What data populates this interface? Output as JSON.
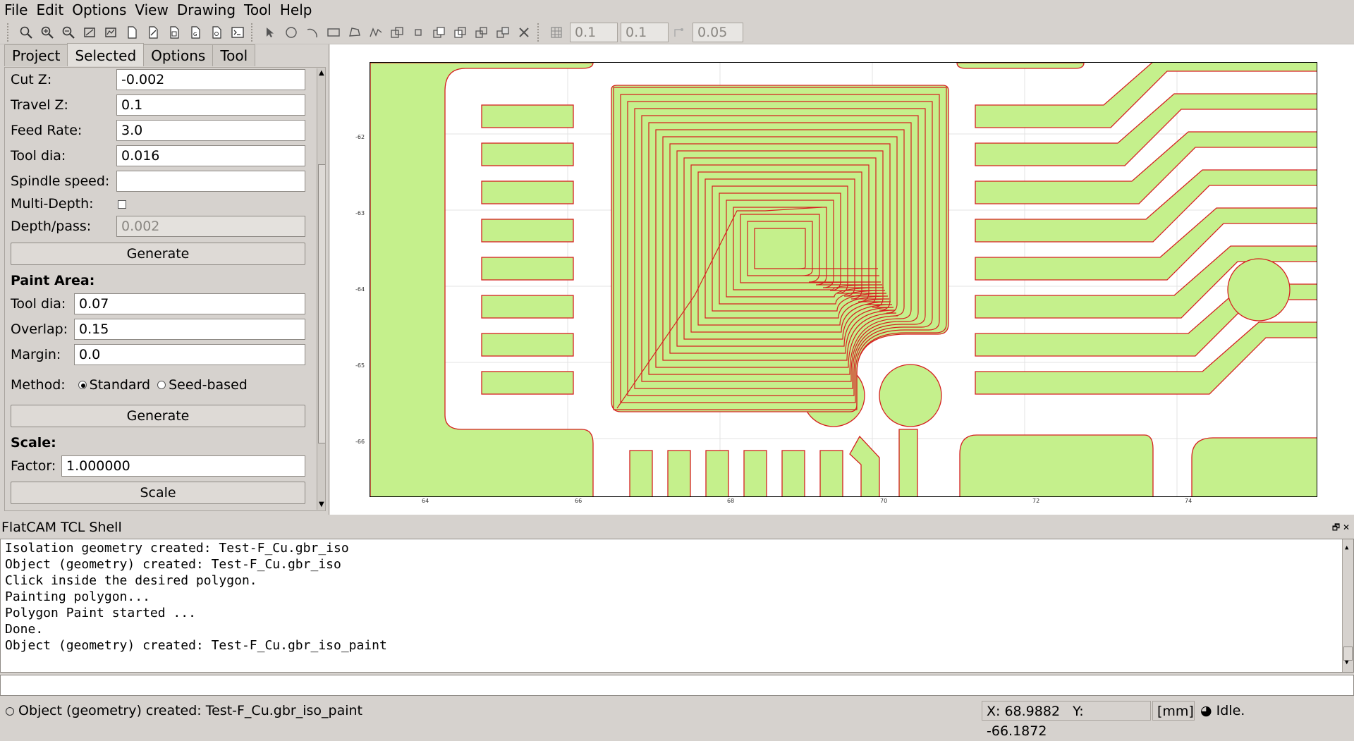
{
  "menu": [
    "File",
    "Edit",
    "Options",
    "View",
    "Drawing",
    "Tool",
    "Help"
  ],
  "toolbar": {
    "icons": [
      "zoom-fit-icon",
      "zoom-in-icon",
      "zoom-out-icon",
      "clear-plot-icon",
      "replot-icon",
      "new-geometry-icon",
      "edit-geometry-icon",
      "update-geometry-icon",
      "open-gerber-icon",
      "open-excellon-icon",
      "shell-icon",
      "select-icon",
      "circle-icon",
      "arc-icon",
      "rectangle-icon",
      "polygon-icon",
      "path-icon",
      "move-icon",
      "copy-icon",
      "union-icon",
      "intersection-icon",
      "subtraction-icon",
      "cut-icon",
      "delete-icon"
    ],
    "grid_x": "0.1",
    "grid_y": "0.1",
    "snap_max": "0.05"
  },
  "tabs": [
    "Project",
    "Selected",
    "Options",
    "Tool"
  ],
  "active_tab": "Selected",
  "form": {
    "cut_z_label": "Cut Z:",
    "cut_z": "-0.002",
    "travel_z_label": "Travel Z:",
    "travel_z": "0.1",
    "feed_rate_label": "Feed Rate:",
    "feed_rate": "3.0",
    "tool_dia_label": "Tool dia:",
    "tool_dia": "0.016",
    "spindle_label": "Spindle speed:",
    "spindle": "",
    "multidepth_label": "Multi-Depth:",
    "depth_pass_label": "Depth/pass:",
    "depth_pass": "0.002",
    "generate_label": "Generate",
    "paint_title": "Paint Area:",
    "paint_tool_dia_label": "Tool dia:",
    "paint_tool_dia": "0.07",
    "overlap_label": "Overlap:",
    "overlap": "0.15",
    "margin_label": "Margin:",
    "margin": "0.0",
    "method_label": "Method:",
    "method_standard": "Standard",
    "method_seed": "Seed-based",
    "generate2_label": "Generate",
    "scale_title": "Scale:",
    "factor_label": "Factor:",
    "factor": "1.000000",
    "scale_button": "Scale"
  },
  "plot": {
    "yticks": [
      "-62",
      "-63",
      "-64",
      "-65",
      "-66"
    ],
    "xticks": [
      "64",
      "66",
      "68",
      "70",
      "72",
      "74"
    ],
    "fill_color": "#c5f08c",
    "outline_color": "#d62020"
  },
  "shell": {
    "title": "FlatCAM TCL Shell",
    "lines": [
      "Isolation geometry created: Test-F_Cu.gbr_iso",
      "Object (geometry) created: Test-F_Cu.gbr_iso",
      "Click inside the desired polygon.",
      "Painting polygon...",
      "Polygon Paint started ...",
      "Done.",
      "Object (geometry) created: Test-F_Cu.gbr_iso_paint"
    ]
  },
  "status": {
    "message": "Object (geometry) created: Test-F_Cu.gbr_iso_paint",
    "x_coord": "X: 68.9882",
    "y_coord": "Y: -66.1872",
    "units": "[mm]",
    "state": "Idle."
  }
}
